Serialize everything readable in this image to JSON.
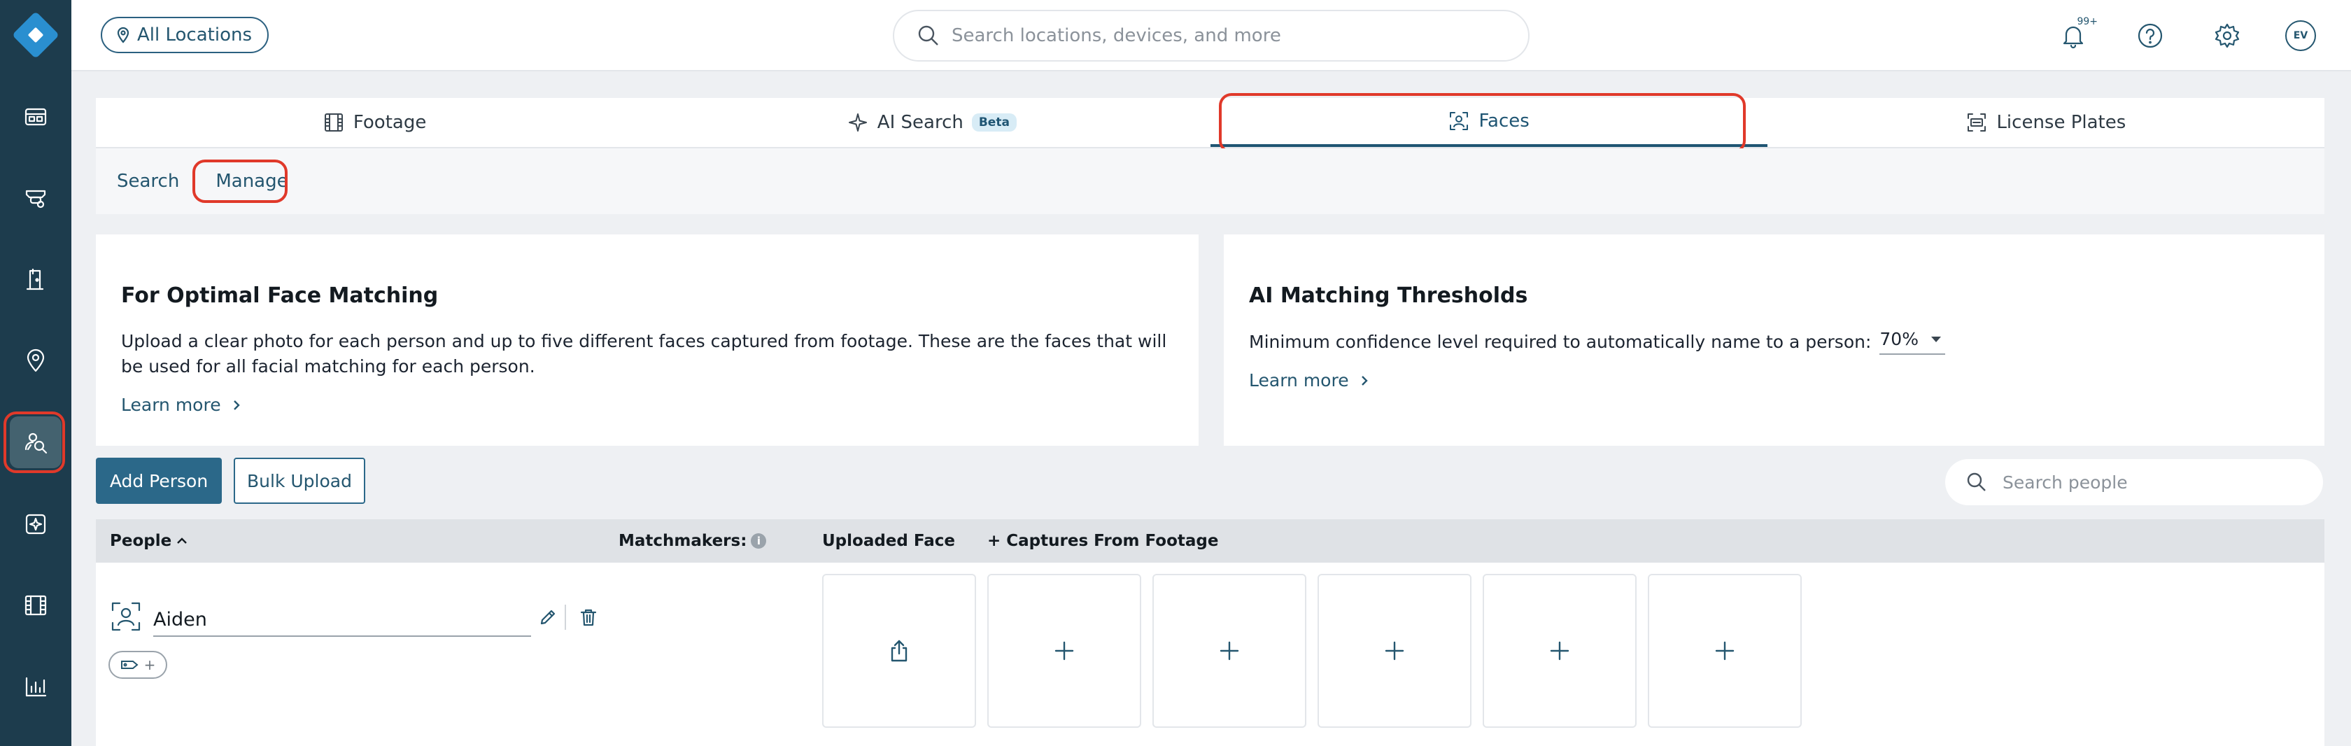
{
  "topbar": {
    "location_button": "All Locations",
    "search_placeholder": "Search locations, devices, and more",
    "notifications_badge": "99+",
    "avatar_initials": "EV"
  },
  "sidebar": {
    "icons": [
      "dashboard-icon",
      "cameras-icon",
      "access-control-icon",
      "locations-icon",
      "people-search-icon",
      "alarms-icon",
      "footage-icon",
      "analytics-icon"
    ],
    "active": "people-search-icon"
  },
  "tabs": [
    {
      "label": "Footage",
      "icon": "film-icon"
    },
    {
      "label": "AI Search",
      "icon": "sparkle-icon",
      "badge": "Beta"
    },
    {
      "label": "Faces",
      "icon": "face-scan-icon",
      "active": true
    },
    {
      "label": "License Plates",
      "icon": "plate-scan-icon"
    }
  ],
  "subtabs": {
    "search": "Search",
    "manage": "Manage",
    "active": "Manage"
  },
  "optimal_card": {
    "title": "For Optimal Face Matching",
    "body": "Upload a clear photo for each person and up to five different faces captured from footage. These are the faces that will be used for all facial matching for each person.",
    "learn_more": "Learn more"
  },
  "threshold_card": {
    "title": "AI Matching Thresholds",
    "label": "Minimum confidence level required to automatically name to a person:",
    "value": "70%",
    "learn_more": "Learn more"
  },
  "actions": {
    "add_person": "Add Person",
    "bulk_upload": "Bulk Upload",
    "search_placeholder": "Search people"
  },
  "table": {
    "headers": {
      "people": "People",
      "matchmakers": "Matchmakers:",
      "uploaded_face": "Uploaded Face",
      "captures": "+ Captures From Footage"
    },
    "rows": [
      {
        "name": "Aiden",
        "tag_add": "+"
      }
    ]
  },
  "colors": {
    "sidebar": "#1d3c4d",
    "accent": "#24566f",
    "primary_button": "#2b6889",
    "highlight": "#e0392a"
  }
}
